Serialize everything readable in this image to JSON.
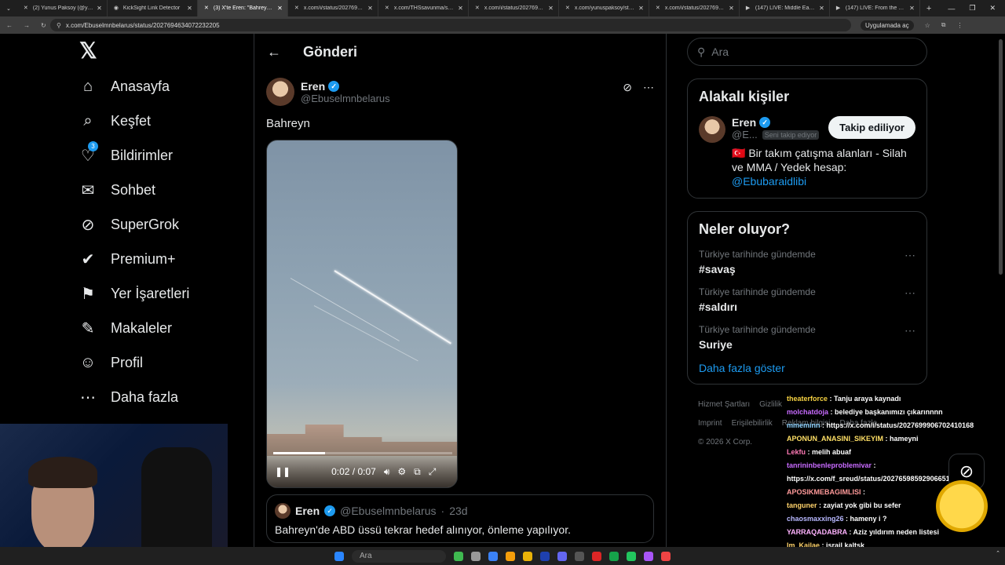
{
  "browser": {
    "tabs": [
      {
        "label": "(2) Yunus Paksoy (@yunuspak",
        "fav": "✕",
        "active": false
      },
      {
        "label": "KickSight Link Detector",
        "fav": "◉",
        "active": false
      },
      {
        "label": "(3) X'te Eren: \"Bahreyn ht",
        "fav": "✕",
        "active": true
      },
      {
        "label": "x.com/i/status/2027694814",
        "fav": "✕",
        "active": false
      },
      {
        "label": "x.com/THSsavunma/status/2",
        "fav": "✕",
        "active": false
      },
      {
        "label": "x.com/i/status/202769174821",
        "fav": "✕",
        "active": false
      },
      {
        "label": "x.com/yunuspaksoy/status/2",
        "fav": "✕",
        "active": false
      },
      {
        "label": "x.com/i/status/2027690964",
        "fav": "✕",
        "active": false
      },
      {
        "label": "(147) LIVE: Middle East real-t",
        "fav": "▶",
        "active": false
      },
      {
        "label": "(147) LIVE: From the Middle E",
        "fav": "▶",
        "active": false
      }
    ],
    "url": "x.com/Ebuselmnbelarus/status/2027694634072232205",
    "app_label": "Uygulamada aç"
  },
  "nav": {
    "items": [
      {
        "label": "Anasayfa",
        "icon": "home-icon",
        "glyph": "⌂"
      },
      {
        "label": "Keşfet",
        "icon": "search-icon",
        "glyph": "⌕"
      },
      {
        "label": "Bildirimler",
        "icon": "bell-icon",
        "glyph": "♡",
        "badge": "3"
      },
      {
        "label": "Sohbet",
        "icon": "mail-icon",
        "glyph": "✉"
      },
      {
        "label": "SuperGrok",
        "icon": "grok-icon",
        "glyph": "⊘"
      },
      {
        "label": "Premium+",
        "icon": "premium-icon",
        "glyph": "✔"
      },
      {
        "label": "Yer İşaretleri",
        "icon": "bookmark-icon",
        "glyph": "⚑"
      },
      {
        "label": "Makaleler",
        "icon": "article-icon",
        "glyph": "✎"
      },
      {
        "label": "Profil",
        "icon": "profile-icon",
        "glyph": "☺"
      },
      {
        "label": "Daha fazla",
        "icon": "more-icon",
        "glyph": "⋯"
      }
    ]
  },
  "main": {
    "title": "Gönderi",
    "post": {
      "name": "Eren",
      "handle": "@Ebuselmnbelarus",
      "text": "Bahreyn",
      "video": {
        "time": "0:02 / 0:07",
        "progress": 0.29
      }
    },
    "quote": {
      "name": "Eren",
      "handle": "@Ebuselmnbelarus",
      "age": "23d",
      "text": "Bahreyn'de ABD üssü tekrar hedef alınıyor, önleme yapılıyor."
    }
  },
  "right": {
    "search_placeholder": "Ara",
    "related": {
      "title": "Alakalı kişiler",
      "name": "Eren",
      "handle": "@E...",
      "follows_you": "Seni takip ediyor",
      "follow_btn": "Takip ediliyor",
      "bio": "🇹🇷 Bir takım çatışma alanları - Silah ve MMA / Yedek hesap: ",
      "bio_link": "@Ebubaraidlibi"
    },
    "trends": {
      "title": "Neler oluyor?",
      "items": [
        {
          "context": "Türkiye tarihinde gündemde",
          "tag": "#savaş"
        },
        {
          "context": "Türkiye tarihinde gündemde",
          "tag": "#saldırı"
        },
        {
          "context": "Türkiye tarihinde gündemde",
          "tag": "Suriye"
        }
      ],
      "show_more": "Daha fazla göster"
    },
    "footer": {
      "links": [
        "Hizmet Şartları",
        "Gizlilik",
        "Imprint",
        "Erişilebilirlik",
        "Reklam bilgisi",
        "Daha fazla ..."
      ],
      "copyright": "© 2026 X Corp."
    }
  },
  "chat": [
    {
      "user": "theaterforce",
      "msg": "Tanju araya kaynadı",
      "color": "#f5d142"
    },
    {
      "user": "molchatdoja",
      "msg": "belediye başkanımızı çıkarınnnn",
      "color": "#c86bff"
    },
    {
      "user": "mmeminn",
      "msg": "https://x.com/i/status/2027699906702410168",
      "color": "#8fd3ff"
    },
    {
      "user": "APONUN_ANASINI_SIKEYIM",
      "msg": "hameyni",
      "color": "#ffe066"
    },
    {
      "user": "Lekfu",
      "msg": "melih abuaf",
      "color": "#ff7ab6"
    },
    {
      "user": "tanrininbenleproblemivar",
      "msg": "https://x.com/f_sreud/status/2027659859290665119",
      "color": "#c86bff"
    },
    {
      "user": "APOSIKMEBAGIMLISI",
      "msg": "",
      "color": "#ff9a9a"
    },
    {
      "user": "tanguner",
      "msg": "zayiat yok gibi bu sefer",
      "color": "#ffd36b"
    },
    {
      "user": "chaosmaxxing26",
      "msg": "hameny i ?",
      "color": "#b8b8ff"
    },
    {
      "user": "YARRAQADABRA",
      "msg": "Aziz yıldırım neden listesi",
      "color": "#ffb3ff"
    },
    {
      "user": "Im_Kailae",
      "msg": "israil kaltsk",
      "color": "#ffd36b"
    }
  ],
  "taskbar": {
    "search": "Ara"
  }
}
